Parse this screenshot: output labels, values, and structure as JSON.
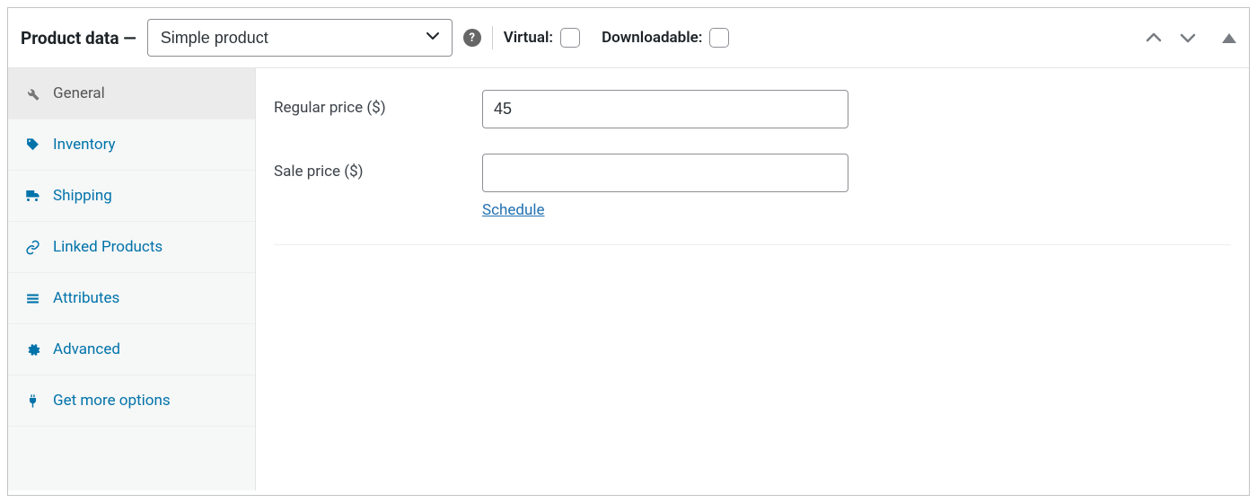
{
  "header": {
    "title": "Product data —",
    "product_type": "Simple product",
    "help_symbol": "?",
    "virtual_label": "Virtual:",
    "downloadable_label": "Downloadable:"
  },
  "tabs": [
    {
      "key": "general",
      "label": "General",
      "active": true
    },
    {
      "key": "inventory",
      "label": "Inventory",
      "active": false
    },
    {
      "key": "shipping",
      "label": "Shipping",
      "active": false
    },
    {
      "key": "linked-products",
      "label": "Linked Products",
      "active": false
    },
    {
      "key": "attributes",
      "label": "Attributes",
      "active": false
    },
    {
      "key": "advanced",
      "label": "Advanced",
      "active": false
    },
    {
      "key": "get-more-options",
      "label": "Get more options",
      "active": false
    }
  ],
  "form": {
    "regular_price_label": "Regular price ($)",
    "regular_price_value": "45",
    "sale_price_label": "Sale price ($)",
    "sale_price_value": "",
    "schedule_label": "Schedule"
  }
}
